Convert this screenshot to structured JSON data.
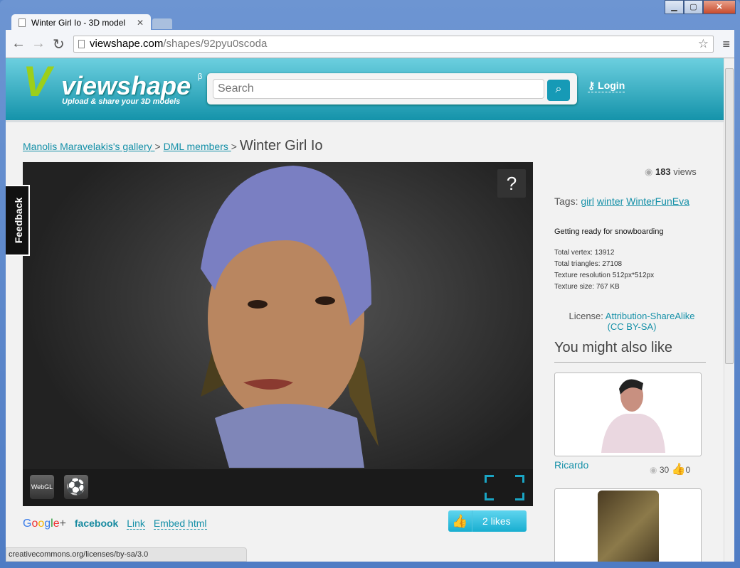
{
  "browser": {
    "tab_title": "Winter Girl Io - 3D model",
    "url_host": "viewshape.com",
    "url_path": "/shapes/92pyu0scoda",
    "status_url": "creativecommons.org/licenses/by-sa/3.0"
  },
  "header": {
    "logo_name": "viewshape",
    "logo_beta": "β",
    "logo_tagline": "Upload & share your  3D models",
    "search_placeholder": "Search",
    "login_label": "Login"
  },
  "breadcrumb": {
    "gallery": "Manolis Maravelakis's gallery ",
    "sep": " > ",
    "group": "DML members ",
    "title": "Winter Girl Io"
  },
  "viewer": {
    "help": "?",
    "webgl": "WebGL"
  },
  "share": {
    "google": [
      "G",
      "o",
      "o",
      "g",
      "l",
      "e",
      "+"
    ],
    "facebook": "facebook",
    "link": "Link",
    "embed": "Embed html"
  },
  "likes": {
    "label": "2 likes"
  },
  "feedback": "Feedback",
  "info": {
    "views_count": "183",
    "views_label": " views",
    "tags_label": "Tags: ",
    "tags": [
      "girl",
      "winter",
      "WinterFunEva"
    ],
    "description": "Getting ready for snowboarding",
    "stats": [
      "Total vertex: 13912",
      "Total triangles: 27108",
      "Texture resolution 512px*512px",
      "Texture size: 767 KB"
    ],
    "license_label": "License: ",
    "license_link": "Attribution-ShareAlike",
    "license_code": "(CC BY-SA)"
  },
  "related": {
    "title": "You might also like",
    "items": [
      {
        "name": "Ricardo",
        "views": "30",
        "likes": "0"
      }
    ]
  }
}
